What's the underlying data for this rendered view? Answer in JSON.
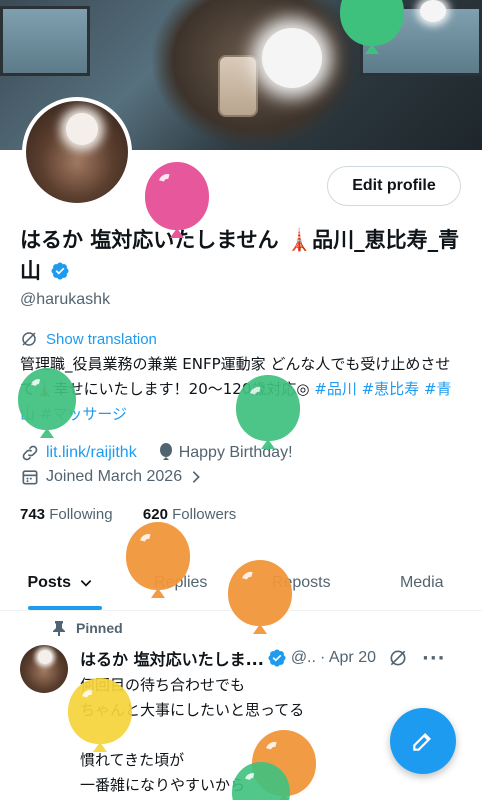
{
  "profile": {
    "name_text": "はるか 塩対応いたしません 🗼品川_恵比寿_青山",
    "handle": "@harukashk",
    "edit_profile_label": "Edit profile",
    "show_translation_label": "Show translation",
    "bio_text": "管理職_役員業務の兼業 ENFP運動家 どんな人でも受け止めさせて🗼幸せにいたします！20〜120歳対応◎ ",
    "bio_tags": "#品川 #恵比寿 #青山 #マッサージ",
    "link": "lit.link/raijithk",
    "birthday": "Happy Birthday!",
    "joined": "Joined March 2026",
    "following_count": "743",
    "following_label": "Following",
    "followers_count": "620",
    "followers_label": "Followers"
  },
  "tabs": [
    {
      "label": "Posts"
    },
    {
      "label": "Replies"
    },
    {
      "label": "Reposts"
    },
    {
      "label": "Media"
    }
  ],
  "pinned_post": {
    "pinned_label": "Pinned",
    "author_name": "はるか 塩対応いたしま...",
    "handle_truncated": "@..",
    "date": "· Apr 20",
    "text_line1": "何回目の待ち合わせでも",
    "text_line2": "ちゃんと大事にしたいと思ってる",
    "text_line3": "慣れてきた頃が",
    "text_line4": "一番雑になりやすいから"
  },
  "colors": {
    "accent": "#1d9bf0",
    "balloon_pink": "#e7579b",
    "balloon_green": "#3fc17e",
    "balloon_orange": "#f2963c",
    "balloon_yellow": "#f5d43a"
  },
  "icons": {
    "verified": "verified-badge-icon",
    "translate": "translate-icon",
    "link": "link-icon",
    "balloon": "balloon-icon",
    "calendar": "calendar-icon",
    "pin": "pin-icon",
    "compose": "compose-icon"
  }
}
